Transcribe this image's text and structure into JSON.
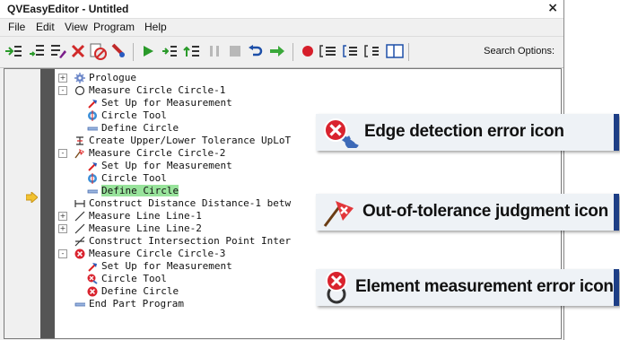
{
  "window": {
    "title": "QVEasyEditor - Untitled",
    "close_label": "×"
  },
  "menu": [
    "File",
    "Edit",
    "View",
    "Program",
    "Help"
  ],
  "toolbar": {
    "search_label": "Search Options:"
  },
  "tree": [
    {
      "text": "Prologue",
      "icon": "gear-icon",
      "expand": "+"
    },
    {
      "text": "Measure Circle Circle-1",
      "icon": "circle-icon",
      "expand": "-"
    },
    {
      "text": "Set Up for Measurement",
      "icon": "setup-icon"
    },
    {
      "text": "Circle Tool",
      "icon": "circle-tool-icon"
    },
    {
      "text": "Define Circle",
      "icon": "define-icon"
    },
    {
      "text": "Create Upper/Lower Tolerance UpLoT",
      "icon": "tolerance-icon"
    },
    {
      "text": "Measure Circle Circle-2",
      "icon": "out-of-tolerance-icon",
      "expand": "-"
    },
    {
      "text": "Set Up for Measurement",
      "icon": "setup-icon"
    },
    {
      "text": "Circle Tool",
      "icon": "circle-tool-icon"
    },
    {
      "text": "Define Circle",
      "icon": "define-icon",
      "selected": true
    },
    {
      "text": "Construct Distance Distance-1 betw",
      "icon": "distance-icon"
    },
    {
      "text": "Measure Line Line-1",
      "icon": "line-icon",
      "expand": "+"
    },
    {
      "text": "Measure Line Line-2",
      "icon": "line-icon",
      "expand": "+"
    },
    {
      "text": "Construct Intersection Point Inter",
      "icon": "intersection-icon"
    },
    {
      "text": "Measure Circle Circle-3",
      "icon": "measurement-error-icon",
      "expand": "-"
    },
    {
      "text": "Set Up for Measurement",
      "icon": "setup-icon"
    },
    {
      "text": "Circle Tool",
      "icon": "edge-error-icon"
    },
    {
      "text": "Define Circle",
      "icon": "measurement-error-icon"
    },
    {
      "text": "End Part Program",
      "icon": "define-icon"
    }
  ],
  "callouts": [
    {
      "label": "Edge detection error icon",
      "icon": "edge-error-icon"
    },
    {
      "label": "Out-of-tolerance judgment icon",
      "icon": "out-of-tolerance-icon"
    },
    {
      "label": "Element measurement error icon",
      "icon": "measurement-error-icon"
    }
  ],
  "colors": {
    "highlight": "#98e39b",
    "callout_accent": "#1d3e86",
    "error_red": "#d9232e"
  }
}
